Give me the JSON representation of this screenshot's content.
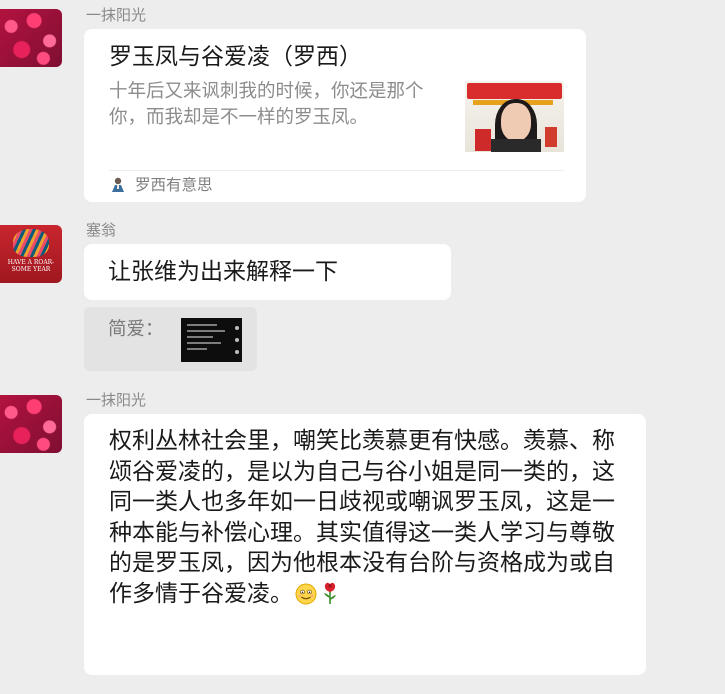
{
  "messages": [
    {
      "sender": "一抹阳光",
      "type": "link-card",
      "card": {
        "title": "罗玉凤与谷爱凌（罗西）",
        "description": "十年后又来讽刺我的时候，你还是那个你，而我却是不一样的罗玉凤。",
        "source": "罗西有意思"
      }
    },
    {
      "sender": "塞翁",
      "type": "text",
      "text": "让张维为出来解释一下",
      "quote": {
        "label": "简爱："
      }
    },
    {
      "sender": "一抹阳光",
      "type": "text",
      "text": "权利丛林社会里，嘲笑比羡慕更有快感。羡慕、称颂谷爱凌的，是以为自己与谷小姐是同一类的，这同一类人也多年如一日歧视或嘲讽罗玉凤，这是一种本能与补偿心理。其实值得这一类人学习与尊敬的是罗玉凤，因为他根本没有台阶与资格成为或自作多情于谷爱凌。",
      "emojis": [
        "smile-emoji",
        "rose-emoji"
      ]
    }
  ],
  "avatars": {
    "tiger_caption": "HAVE A ROAR-SOME YEAR"
  },
  "colors": {
    "background": "#ededed",
    "bubble": "#ffffff",
    "name": "#8a8a8a",
    "quote_bg": "#e3e3e3"
  }
}
